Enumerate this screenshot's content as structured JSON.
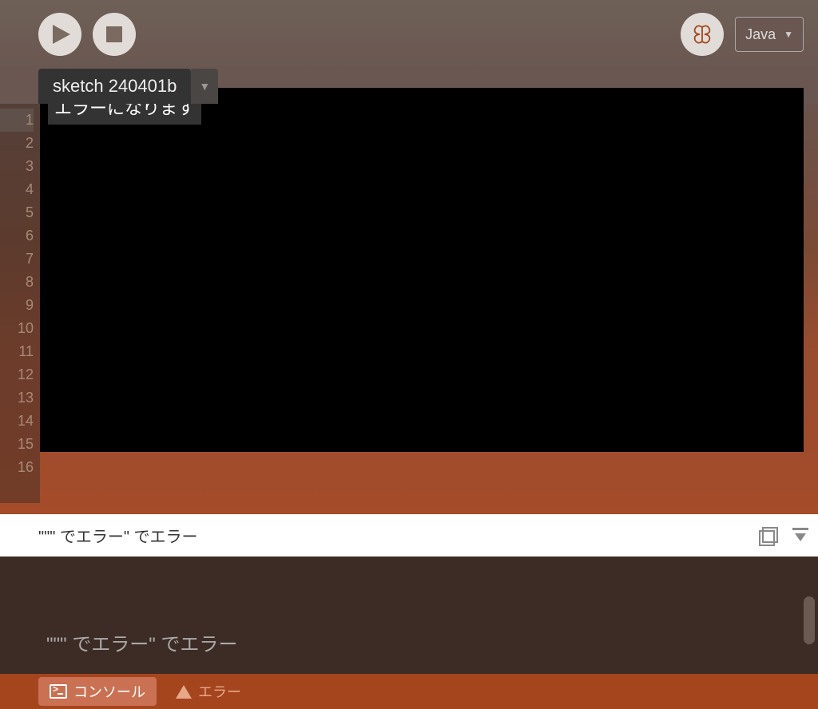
{
  "toolbar": {
    "mode": "Java"
  },
  "tabs": {
    "active": "sketch 240401b"
  },
  "editor": {
    "lines": [
      "1",
      "2",
      "3",
      "4",
      "5",
      "6",
      "7",
      "8",
      "9",
      "10",
      "11",
      "12",
      "13",
      "14",
      "15",
      "16"
    ],
    "code_line_1": "エラーになります"
  },
  "status": {
    "message": "\"\"\" でエラー\" でエラー"
  },
  "console": {
    "output": "\"\"\" でエラー\" でエラー"
  },
  "bottom_tabs": {
    "console": "コンソール",
    "errors": "エラー"
  }
}
